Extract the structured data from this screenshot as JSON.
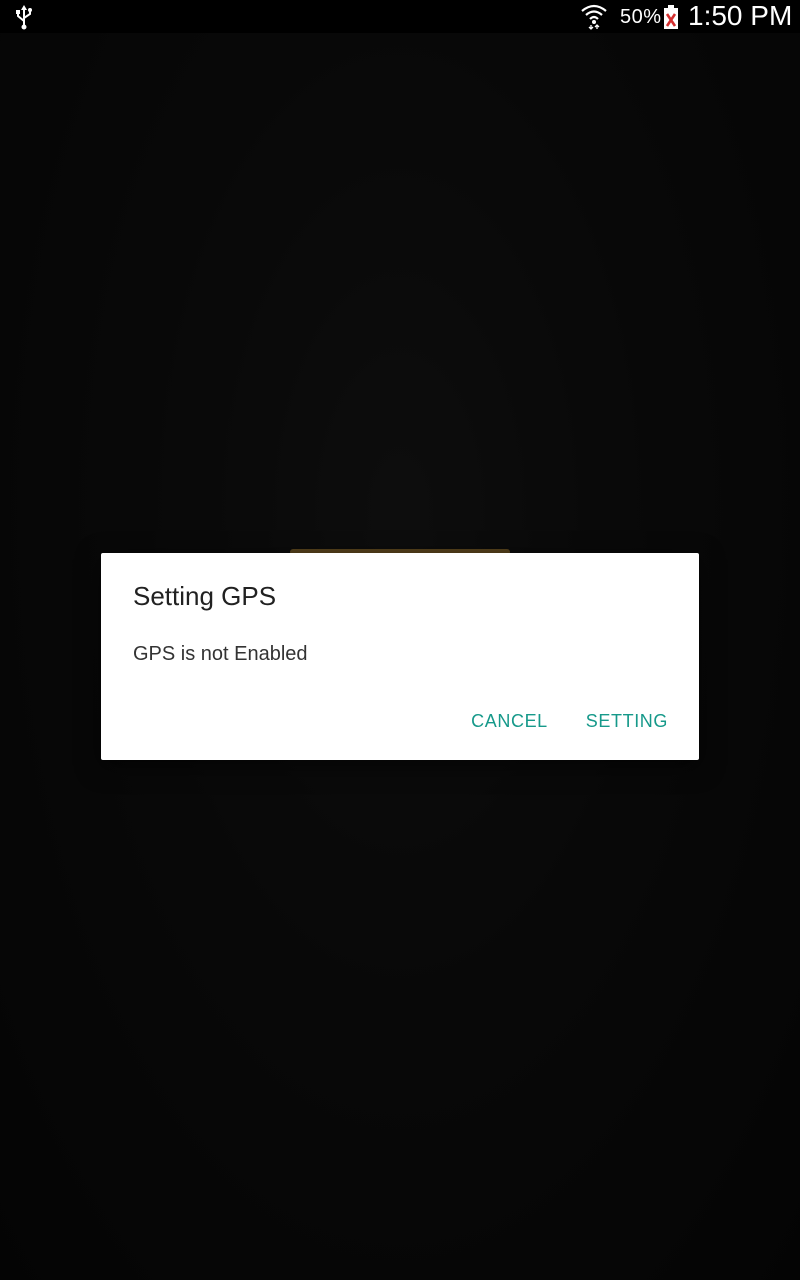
{
  "status_bar": {
    "usb_icon": "usb-icon",
    "wifi_icon": "wifi-icon",
    "battery_percent": "50%",
    "battery_icon": "battery-charging-icon",
    "time": "1:50 PM"
  },
  "dialog": {
    "title": "Setting GPS",
    "message": "GPS is not Enabled",
    "cancel_label": "CANCEL",
    "setting_label": "SETTING"
  },
  "colors": {
    "accent": "#16998a",
    "dialog_background": "#ffffff",
    "screen_background": "#121212",
    "status_bar": "#000000"
  }
}
